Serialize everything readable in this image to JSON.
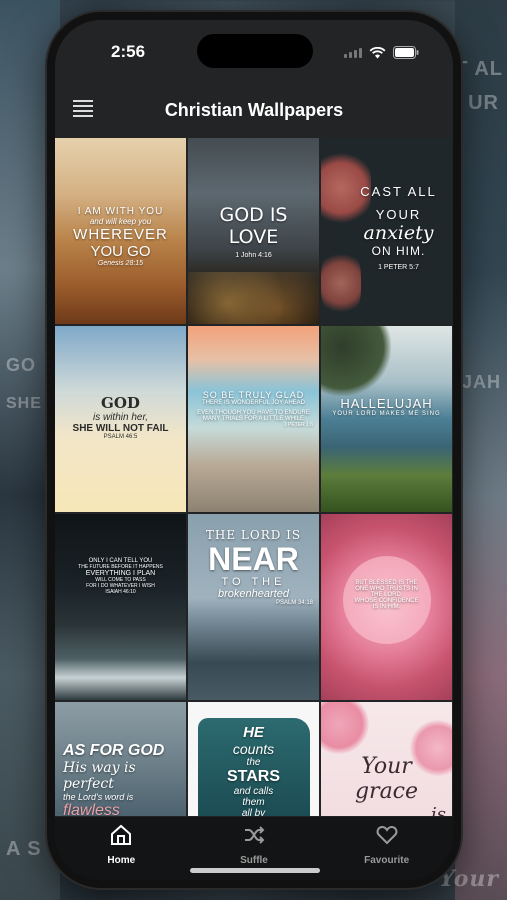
{
  "status_bar": {
    "time": "2:56"
  },
  "header": {
    "title": "Christian Wallpapers"
  },
  "backdrop_text": {
    "right_top": "T AL",
    "right_mid": "UR",
    "left_mid": "GO",
    "left_mid2": "SHE W",
    "right_lujah": "UJAH",
    "bottom_left": "A S",
    "bottom_right": "Your"
  },
  "wallpapers": [
    {
      "id": "w1",
      "lines": [
        "I AM WITH YOU",
        "and will keep you",
        "WHEREVER",
        "YOU GO"
      ],
      "ref": "Genesis 28:15"
    },
    {
      "id": "w2",
      "lines": [
        "GOD IS LOVE"
      ],
      "ref": "1 John 4:16"
    },
    {
      "id": "w3",
      "lines": [
        "CAST ALL",
        "YOUR",
        "anxiety",
        "ON HIM."
      ],
      "ref": "1 PETER 5:7"
    },
    {
      "id": "w4",
      "lines": [
        "GOD",
        "is within her,",
        "SHE WILL NOT FAIL"
      ],
      "ref": "PSALM 46:5"
    },
    {
      "id": "w5",
      "lines": [
        "SO BE TRULY GLAD",
        "THERE IS WONDERFUL JOY AHEAD",
        "EVEN THOUGH YOU HAVE TO ENDURE",
        "MANY TRIALS FOR A LITTLE WHILE"
      ],
      "ref": "1 PETER 1:6"
    },
    {
      "id": "w6",
      "lines": [
        "HALLELUJAH",
        "YOUR LORD MAKES ME SING"
      ],
      "ref": ""
    },
    {
      "id": "w7",
      "lines": [
        "ONLY I CAN TELL YOU",
        "THE FUTURE BEFORE IT HAPPENS",
        "EVERYTHING I PLAN",
        "WILL COME TO PASS",
        "FOR I DO WHATEVER I WISH"
      ],
      "ref": "ISAIAH 46:10"
    },
    {
      "id": "w8",
      "lines": [
        "THE LORD IS",
        "NEAR",
        "TO THE",
        "brokenhearted"
      ],
      "ref": "PSALM 34:18"
    },
    {
      "id": "w9",
      "lines": [
        "BUT BLESSED IS THE",
        "ONE WHO TRUSTS IN",
        "THE LORD,",
        "WHOSE CONFIDENCE",
        "IS IN HIM."
      ],
      "ref": ""
    },
    {
      "id": "w10",
      "lines": [
        "AS FOR GOD",
        "His way is",
        "perfect",
        "the Lord's word is",
        "flawless"
      ],
      "ref": ""
    },
    {
      "id": "w11",
      "lines": [
        "HE",
        "counts",
        "the",
        "STARS",
        "and calls",
        "them",
        "all by"
      ],
      "ref": ""
    },
    {
      "id": "w12",
      "lines": [
        "Your",
        "grace",
        "is"
      ],
      "ref": ""
    }
  ],
  "tabs": [
    {
      "label": "Home",
      "icon": "home-icon",
      "active": true
    },
    {
      "label": "Suffle",
      "icon": "shuffle-icon",
      "active": false
    },
    {
      "label": "Favourite",
      "icon": "heart-icon",
      "active": false
    }
  ],
  "colors": {
    "active_tab": "#ffffff",
    "inactive_tab": "#9a9a9a",
    "bar_bg": "#131415"
  }
}
